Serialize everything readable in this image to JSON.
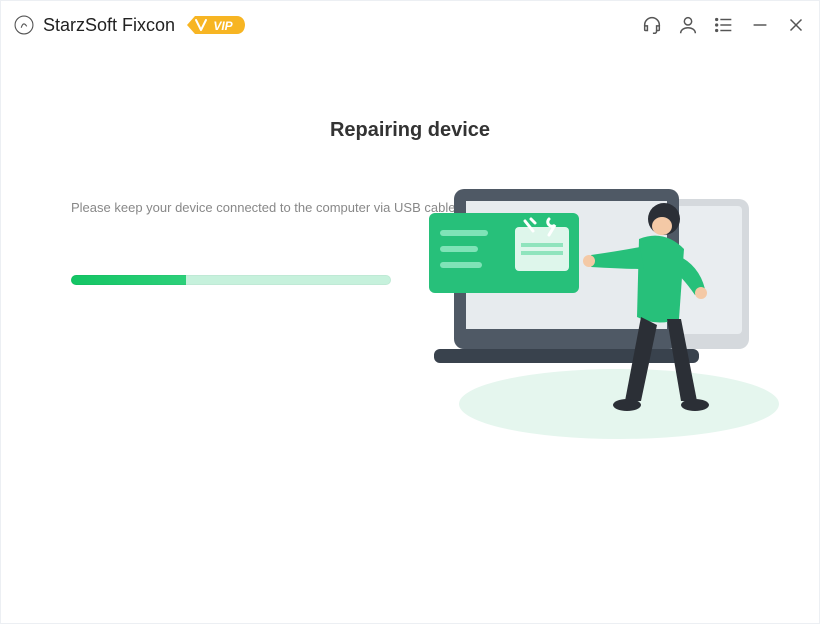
{
  "header": {
    "app_title": "StarzSoft Fixcon",
    "vip_badge": "VIP",
    "colors": {
      "accent": "#14c564",
      "vip_bg": "#f7b523",
      "vip_text": "#ffffff"
    }
  },
  "main": {
    "heading": "Repairing device",
    "instruction": "Please keep your device connected to the computer via USB cable.",
    "progress_percent": 36
  },
  "icons": {
    "support": "headset-icon",
    "account": "user-icon",
    "menu": "list-icon",
    "minimize": "minus-icon",
    "close": "x-icon"
  }
}
